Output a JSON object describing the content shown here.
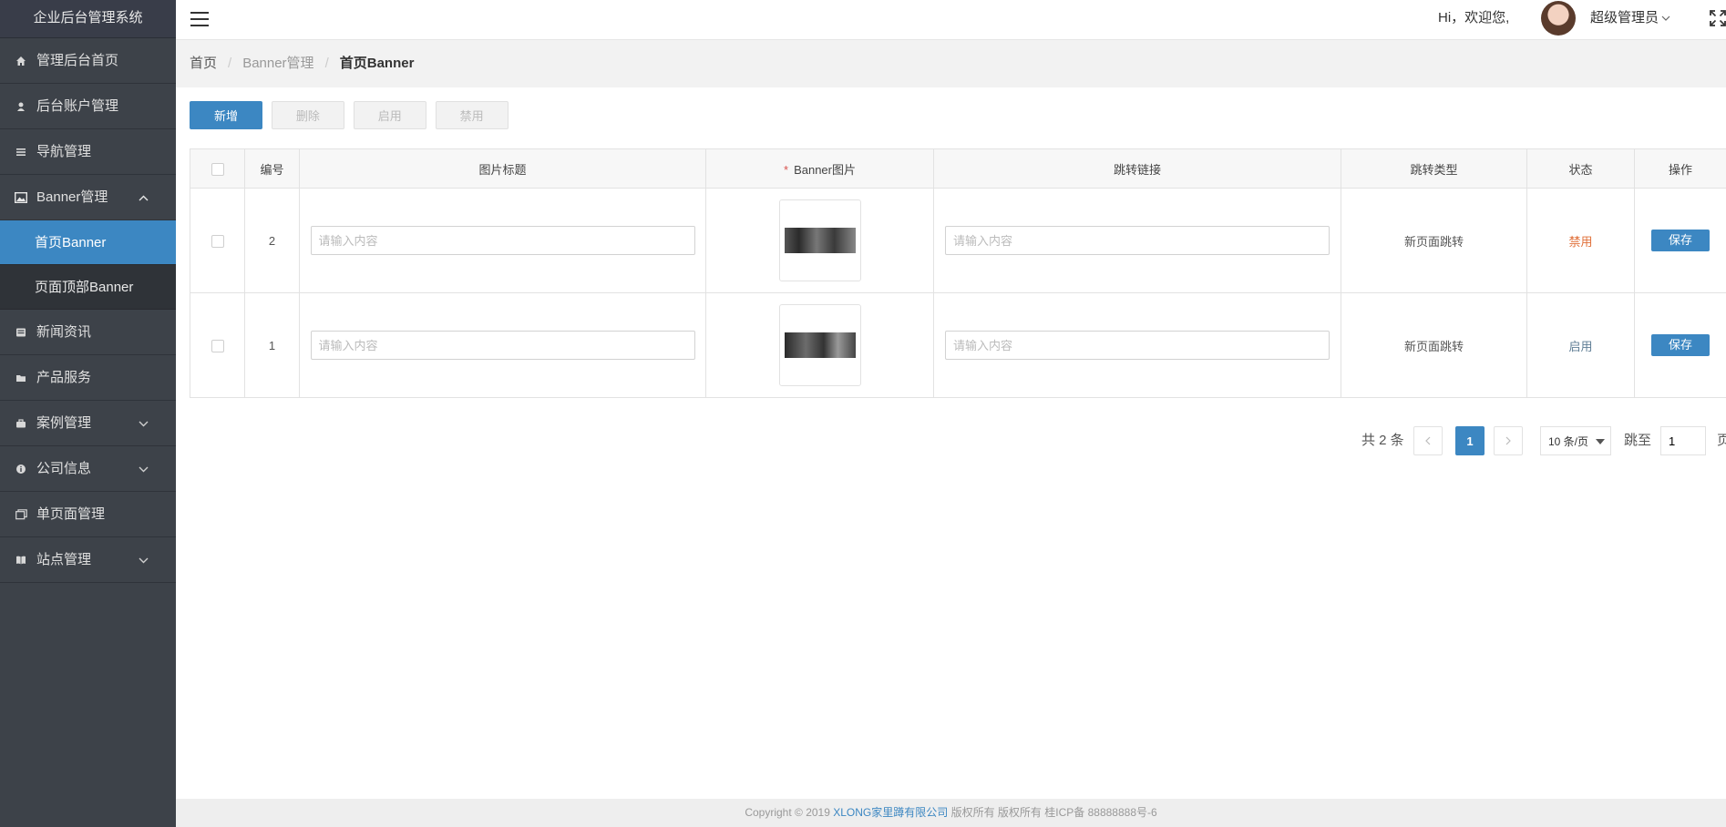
{
  "app": {
    "title": "企业后台管理系统"
  },
  "sidebar": {
    "items": [
      {
        "label": "管理后台首页",
        "icon": "home-icon"
      },
      {
        "label": "后台账户管理",
        "icon": "user-icon"
      },
      {
        "label": "导航管理",
        "icon": "list-icon"
      },
      {
        "label": "Banner管理",
        "icon": "image-icon",
        "expanded": true,
        "children": [
          {
            "label": "首页Banner",
            "active": true
          },
          {
            "label": "页面顶部Banner"
          }
        ]
      },
      {
        "label": "新闻资讯",
        "icon": "news-icon"
      },
      {
        "label": "产品服务",
        "icon": "folder-icon"
      },
      {
        "label": "案例管理",
        "icon": "briefcase-icon",
        "arrow": "chevron-down"
      },
      {
        "label": "公司信息",
        "icon": "info-icon",
        "arrow": "chevron-down"
      },
      {
        "label": "单页面管理",
        "icon": "page-icon"
      },
      {
        "label": "站点管理",
        "icon": "book-icon",
        "arrow": "chevron-down"
      }
    ]
  },
  "header": {
    "greeting": "Hi，欢迎您,",
    "admin_name": "超级管理员"
  },
  "breadcrumb": {
    "home": "首页",
    "parent": "Banner管理",
    "current": "首页Banner"
  },
  "toolbar": {
    "add": "新增",
    "delete": "删除",
    "enable": "启用",
    "disable": "禁用"
  },
  "table": {
    "columns": [
      "编号",
      "图片标题",
      "Banner图片",
      "跳转链接",
      "跳转类型",
      "状态",
      "操作"
    ],
    "rows": [
      {
        "id": "2",
        "title_placeholder": "请输入内容",
        "link_placeholder": "请输入内容",
        "jump_type": "新页面跳转",
        "status": "禁用",
        "action": "保存"
      },
      {
        "id": "1",
        "title_placeholder": "请输入内容",
        "link_placeholder": "请输入内容",
        "jump_type": "新页面跳转",
        "status": "启用",
        "action": "保存"
      }
    ]
  },
  "pagination": {
    "total": "共 2 条",
    "current_page": "1",
    "page_size": "10 条/页",
    "jump_label": "跳至",
    "jump_value": "1",
    "page_suffix": "页"
  },
  "footer": {
    "prefix": "Copyright © 2019",
    "company": "XLONG家里蹲有限公司",
    "suffix": "版权所有 版权所有 桂ICP备 88888888号-6"
  },
  "colors": {
    "primary": "#3c87c2",
    "sidebar_bg": "#3d4249",
    "status_disabled": "#e0703a",
    "status_enabled": "#5f7e95"
  }
}
